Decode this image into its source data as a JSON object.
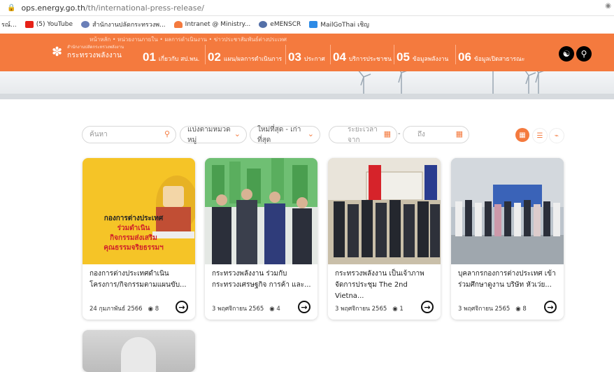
{
  "browser": {
    "url_host": "ops.energy.go.th",
    "url_path": "/th/international-press-release/",
    "bookmarks": [
      {
        "label": "รณ์...",
        "color": "#999999"
      },
      {
        "label": "(5) YouTube",
        "color": "#e62117"
      },
      {
        "label": "สำนักงานปลัดกระทรวงพ...",
        "color": "#6a7fb8"
      },
      {
        "label": "Intranet @ Ministry...",
        "color": "#f47a3e"
      },
      {
        "label": "eMENSCR",
        "color": "#5470a8"
      },
      {
        "label": "MailGoThai เชิญ",
        "color": "#2d8be6"
      }
    ]
  },
  "site": {
    "breadcrumb": "หน้าหลัก • หน่วยงานภายใน • ผลการดำเนินงาน • ข่าวประชาสัมพันธ์ต่างประเทศ",
    "logo_small": "สำนักงานปลัดกระทรวงพลังงาน",
    "logo_main": "กระทรวงพลังงาน",
    "menu": [
      {
        "num": "01",
        "label": "เกี่ยวกับ สป.พน."
      },
      {
        "num": "02",
        "label": "แผน/ผลการดำเนินการ"
      },
      {
        "num": "03",
        "label": "ประกาศ"
      },
      {
        "num": "04",
        "label": "บริการประชาชน"
      },
      {
        "num": "05",
        "label": "ข้อมูลพลังงาน"
      },
      {
        "num": "06",
        "label": "ข้อมูลเปิดสาธารณะ"
      }
    ],
    "accent": "#f47a3e"
  },
  "filters": {
    "search_placeholder": "ค้นหา",
    "category": "แบ่งตามหมวดหมู่",
    "sort": "ใหม่ที่สุด - เก่าที่สุด",
    "date_from": "ระยะเวลาจาก",
    "date_to": "ถึง",
    "date_sep": "-"
  },
  "cards": [
    {
      "title": "กองการต่างประเทศดำเนินโครงการ/กิจกรรมตามแผนขับ...",
      "date": "24 กุมภาพันธ์ 2566",
      "views": "8",
      "poster_lines": [
        "กองการต่างประเทศ",
        "ร่วมดำเนิน",
        "กิจกรรมส่งเสริม",
        "คุณธรรมจริยธรรมฯ"
      ]
    },
    {
      "title": "กระทรวงพลังงาน ร่วมกับกระทรวงเศรษฐกิจ การค้า และ...",
      "date": "3 พฤศจิกายน 2565",
      "views": "4"
    },
    {
      "title": "กระทรวงพลังงาน เป็นเจ้าภาพจัดการประชุม The 2nd Vietna...",
      "date": "3 พฤศจิกายน 2565",
      "views": "1"
    },
    {
      "title": "บุคลากรกองการต่างประเทศ เข้าร่วมศึกษาดูงาน บริษัท หัวเว่ย...",
      "date": "3 พฤศจิกายน 2565",
      "views": "8"
    }
  ]
}
